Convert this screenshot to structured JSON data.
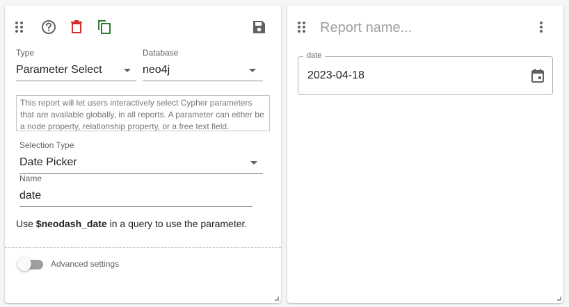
{
  "left_card": {
    "type": {
      "label": "Type",
      "value": "Parameter Select"
    },
    "database": {
      "label": "Database",
      "value": "neo4j"
    },
    "description": "This report will let users interactively select Cypher parameters that are available globally, in all reports. A parameter can either be a node property, relationship property, or a free text field.",
    "selection_type": {
      "label": "Selection Type",
      "value": "Date Picker"
    },
    "name": {
      "label": "Name",
      "value": "date"
    },
    "usage": {
      "prefix": "Use ",
      "param": "$neodash_date",
      "suffix": " in a query to use the parameter."
    },
    "advanced_settings": {
      "label": "Advanced settings",
      "enabled": false
    },
    "icons": [
      "drag-handle-icon",
      "help-icon",
      "delete-icon",
      "copy-icon",
      "save-icon"
    ],
    "colors": {
      "delete": "#d32f2f",
      "copy": "#2e7d32"
    }
  },
  "right_card": {
    "report_name": {
      "placeholder": "Report name..."
    },
    "date_field": {
      "label": "date",
      "value": "2023-04-18"
    },
    "icons": [
      "drag-handle-icon",
      "more-vert-icon",
      "calendar-icon"
    ]
  }
}
